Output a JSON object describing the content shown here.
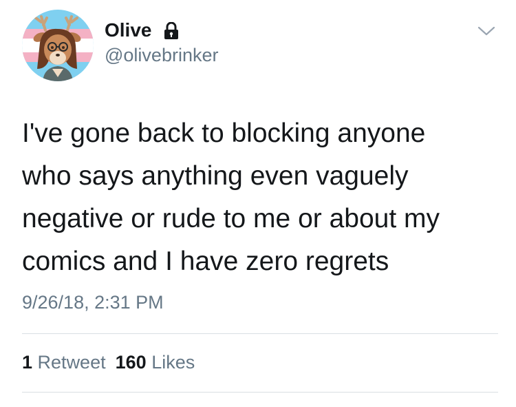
{
  "user": {
    "display_name": "Olive",
    "handle": "@olivebrinker",
    "avatar_icon": "deer-avatar",
    "lock_icon": "lock-icon"
  },
  "tweet": {
    "text_lines": [
      "I've gone back to blocking anyone",
      "who says anything even vaguely",
      "negative or rude to me or about my",
      "comics and I have zero regrets"
    ],
    "timestamp": "9/26/18, 2:31 PM"
  },
  "stats": {
    "retweets_count": "1",
    "retweets_label": "Retweet",
    "likes_count": "160",
    "likes_label": "Likes"
  },
  "colors": {
    "text": "#14171a",
    "secondary": "#657786",
    "divider": "#d9dee3",
    "avatar_blue": "#7fd0f0",
    "avatar_pink": "#f4b1c4"
  }
}
